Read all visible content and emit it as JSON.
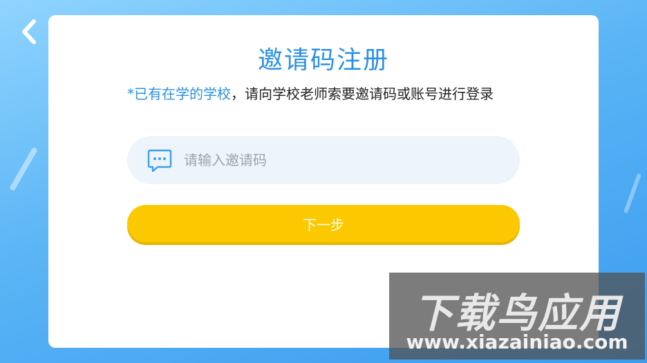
{
  "header": {
    "title": "邀请码注册"
  },
  "hint": {
    "highlight": "*已有在学的学校",
    "rest": "，请向学校老师索要邀请码或账号进行登录"
  },
  "invite_field": {
    "value": "",
    "placeholder": "请输入邀请码",
    "icon": "message-icon"
  },
  "next_button": {
    "label": "下一步"
  },
  "watermark": {
    "title": "下载鸟应用",
    "url": "www.xiazainiao.com"
  },
  "colors": {
    "accent": "#2a90e6",
    "button": "#fcc800",
    "field_bg": "#eef4fb"
  }
}
